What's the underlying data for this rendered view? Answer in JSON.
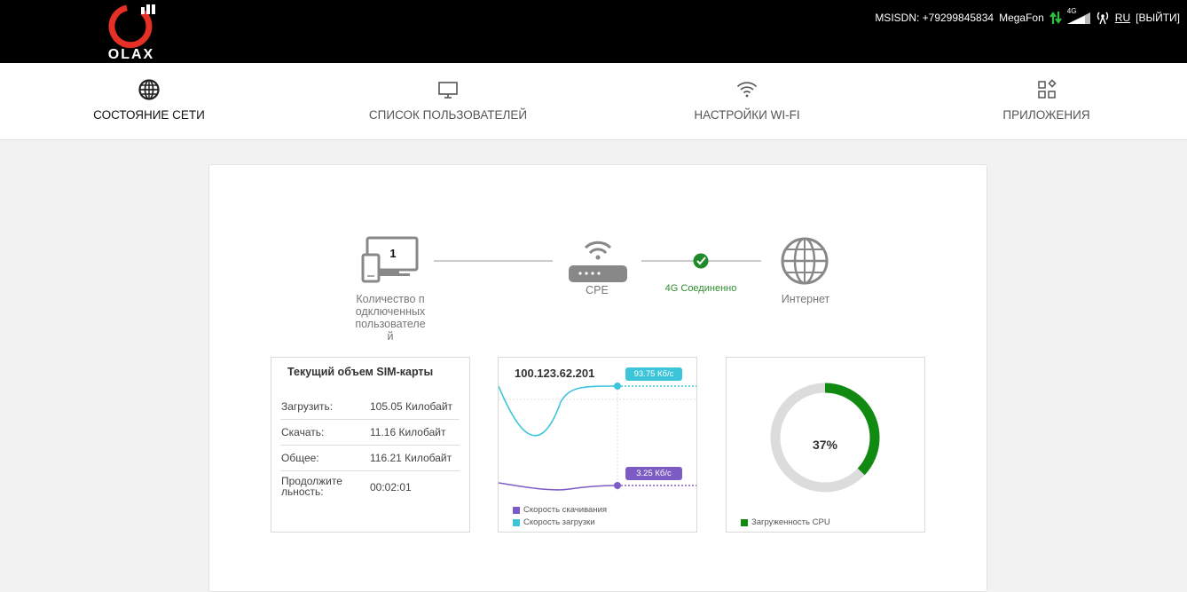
{
  "header": {
    "logo_text": "OLAX",
    "msisdn": "MSISDN: +79299845834",
    "operator": "MegaFon",
    "network_type": "4G",
    "language": "RU",
    "logout": "[ВЫЙТИ]",
    "icons": [
      "data-transfer-arrows-icon",
      "signal-strength-icon",
      "antenna-icon"
    ]
  },
  "nav": {
    "items": [
      {
        "label": "СОСТОЯНИЕ СЕТИ",
        "icon": "globe-icon",
        "active": true
      },
      {
        "label": "СПИСОК ПОЛЬЗОВАТЕЛЕЙ",
        "icon": "monitor-icon",
        "active": false
      },
      {
        "label": "НАСТРОЙКИ WI-FI",
        "icon": "wifi-icon",
        "active": false
      },
      {
        "label": "ПРИЛОЖЕНИЯ",
        "icon": "apps-grid-icon",
        "active": false
      }
    ]
  },
  "diagram": {
    "users_count": "1",
    "users_label": "Количество подключенных пользователей",
    "cpe_label": "CPE",
    "connection_status": "4G Соединенно",
    "internet_label": "Интернет",
    "status_color": "#2d8a2d"
  },
  "sim": {
    "title": "Текущий объем SIM-карты",
    "rows": [
      {
        "key": "Загрузить:",
        "value": "105.05 Килобайт"
      },
      {
        "key": "Скачать:",
        "value": "11.16 Килобайт"
      },
      {
        "key": "Общее:",
        "value": "116.21 Килобайт"
      },
      {
        "key": "Продолжительность:",
        "value": "00:02:01"
      }
    ]
  },
  "traffic": {
    "ip": "100.123.62.201",
    "upload_speed": "93.75 Кб/с",
    "download_speed": "3.25 Кб/с",
    "legend_download": "Скорость скачивания",
    "legend_upload": "Скорость загрузки",
    "download_color": "#7c5cc4",
    "upload_color": "#3cc4d8"
  },
  "cpu": {
    "percent_label": "37%",
    "percent_value": 37,
    "legend": "Загруженность CPU",
    "color": "#118a11"
  }
}
